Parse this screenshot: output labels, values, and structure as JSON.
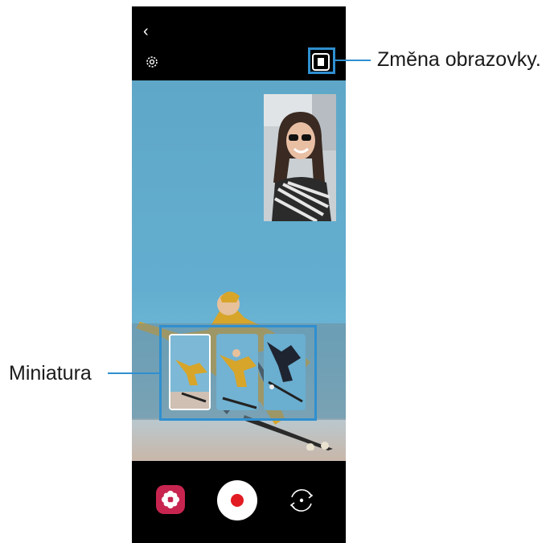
{
  "phone": {
    "top_bar": {
      "back_icon": "chevron-left-icon",
      "back_glyph": "‹",
      "settings_icon": "gear-icon",
      "screen_change_icon": "split-view-icon"
    },
    "bottom_bar": {
      "filter_icon": "flower-icon",
      "record_icon": "record-icon",
      "flip_icon": "camera-flip-icon"
    },
    "thumbnails_count_visible": 3
  },
  "annotations": {
    "screen_change_label": "Změna obrazovky.",
    "thumbnail_label": "Miniatura"
  },
  "colors": {
    "callout": "#2f8fd0",
    "record": "#e21b23",
    "filter": "#c7254f",
    "sky": "#63aed0"
  }
}
